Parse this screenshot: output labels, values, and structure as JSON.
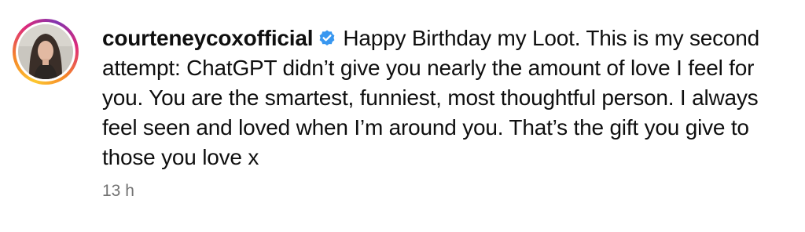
{
  "post": {
    "username": "courteneycoxofficial",
    "verified_icon": "verified-badge-icon",
    "caption": "Happy Birthday my Loot. This is my second attempt: ChatGPT didn’t give you nearly the amount of love I feel for you. You are the smartest, funniest, most thoughtful person. I always feel seen and loved when I’m around you. That’s the gift you give to those you love x",
    "timestamp": "13 h"
  },
  "colors": {
    "verified": "#3897f0",
    "timestamp": "#737373",
    "text": "#0f0f0f"
  }
}
